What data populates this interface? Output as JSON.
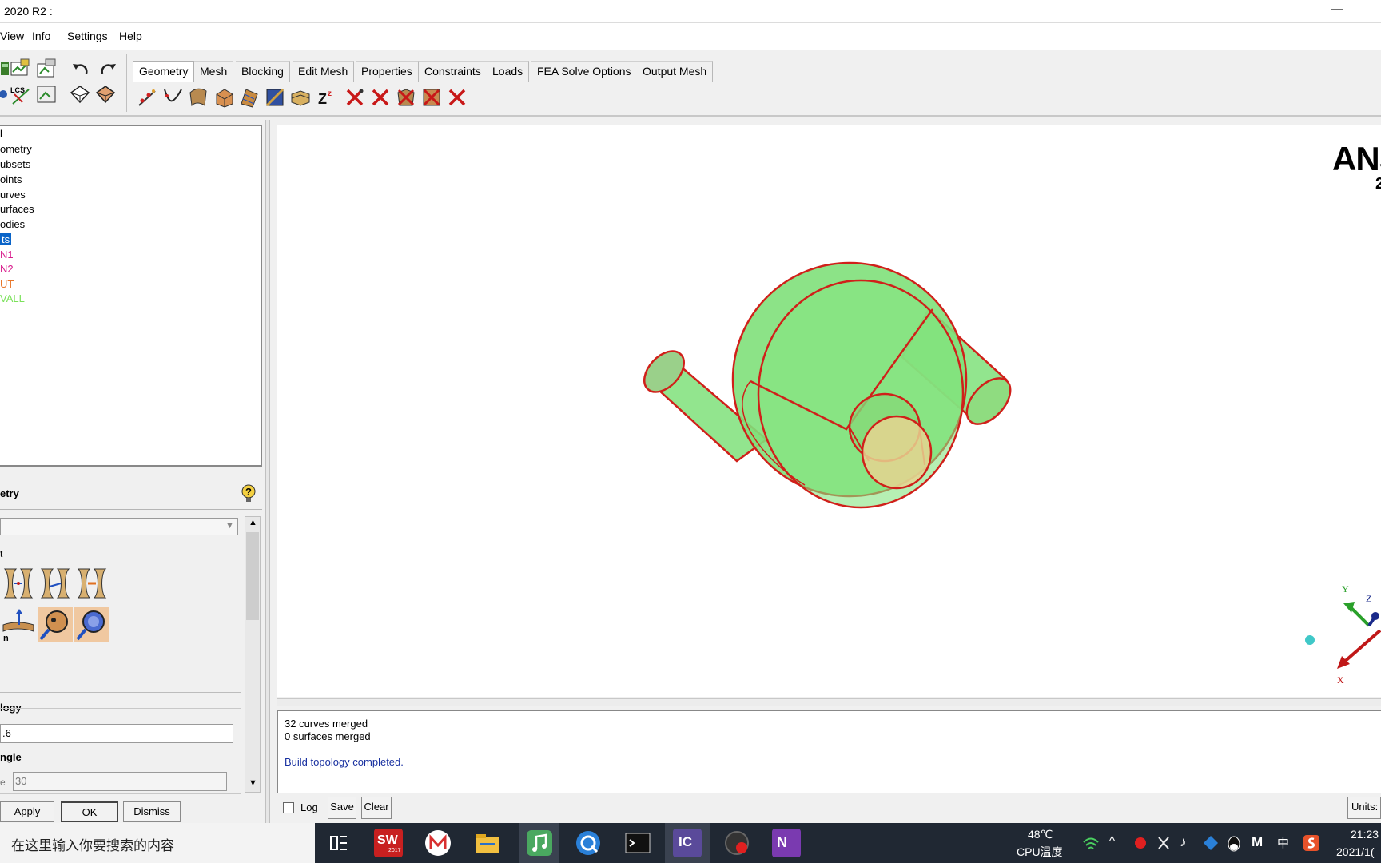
{
  "window": {
    "title": "2020 R2 :",
    "minimize_glyph": "—"
  },
  "menu": [
    "View",
    "Info",
    "Settings",
    "Help"
  ],
  "tabs": [
    "Geometry",
    "Mesh",
    "Blocking",
    "Edit Mesh",
    "Properties",
    "Constraints",
    "Loads",
    "FEA Solve Options",
    "Output Mesh"
  ],
  "tree": {
    "items": [
      {
        "label": "l",
        "color": "#000000"
      },
      {
        "label": "ometry",
        "color": "#000000"
      },
      {
        "label": "ubsets",
        "color": "#000000"
      },
      {
        "label": "oints",
        "color": "#000000"
      },
      {
        "label": "urves",
        "color": "#000000"
      },
      {
        "label": "urfaces",
        "color": "#000000"
      },
      {
        "label": "odies",
        "color": "#000000"
      },
      {
        "label": "ts",
        "color": "#ffffff"
      },
      {
        "label": "N1",
        "color": "#d81b8c"
      },
      {
        "label": "N2",
        "color": "#d81b8c"
      },
      {
        "label": "UT",
        "color": "#e8762a"
      },
      {
        "label": "VALL",
        "color": "#7be15a"
      }
    ]
  },
  "panel": {
    "title": "etry",
    "small_label": "t",
    "topology_label": "logy",
    "tolerance_value": ".6",
    "angle_label": "ngle",
    "angle_prefix": "e",
    "angle_value": "30",
    "apply_label": "Apply",
    "ok_label": "OK",
    "dismiss_label": "Dismiss"
  },
  "viewport": {
    "brand_main": "ANS",
    "brand_sub": "2",
    "axes": {
      "y": "Y",
      "z": "Z",
      "x": "X"
    }
  },
  "messages": {
    "lines": [
      "32 curves merged",
      "0 surfaces merged",
      "",
      "Build topology completed."
    ],
    "log_label": "Log",
    "save_label": "Save",
    "clear_label": "Clear",
    "units_label": "Units:"
  },
  "taskbar": {
    "search_placeholder": "在这里输入你要搜索的内容",
    "apps": [
      "task-view",
      "solidworks",
      "m-app",
      "file-explorer",
      "music",
      "browser-q",
      "terminal",
      "icem-cfd",
      "recorder",
      "onenote"
    ],
    "solidworks_label": "SW",
    "solidworks_year": "2017",
    "icem_label": "IC",
    "onenote_label": "N",
    "temp": "48℃",
    "temp_label": "CPU温度",
    "ime": "中",
    "m_label": "M",
    "time": "21:23",
    "date": "2021/1("
  },
  "colors": {
    "model_fill": "#7fe07a",
    "model_edge": "#d0201a",
    "accent": "#0a64c8"
  }
}
